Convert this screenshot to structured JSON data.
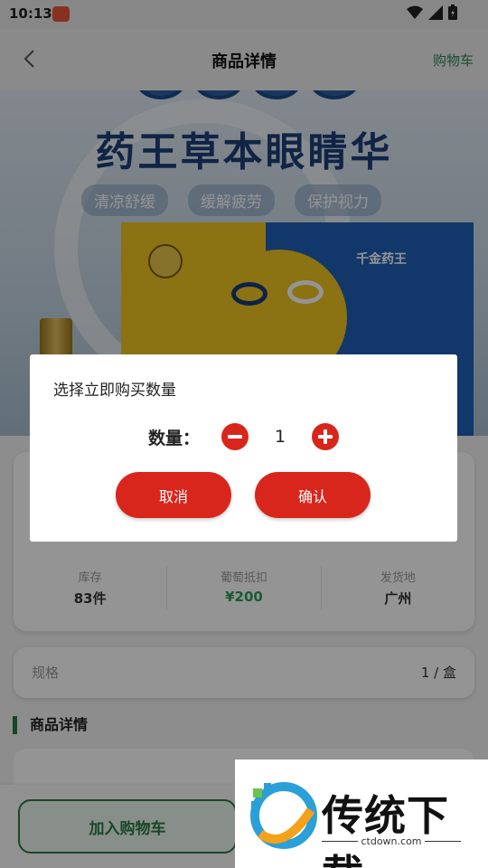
{
  "status_bar": {
    "time": "10:13"
  },
  "nav": {
    "title": "商品详情",
    "cart_link": "购物车"
  },
  "banner": {
    "headline": "药王草本眼睛华",
    "tags": [
      "清凉舒缓",
      "缓解疲劳",
      "保护视力"
    ],
    "box_brand": "千金药王"
  },
  "stats": [
    {
      "label": "库存",
      "value": "83件"
    },
    {
      "label": "葡萄抵扣",
      "value": "¥200"
    },
    {
      "label": "发货地",
      "value": "广州"
    }
  ],
  "spec": {
    "label": "规格",
    "value": "1 / 盒"
  },
  "section": {
    "title": "商品详情"
  },
  "bottom": {
    "add_to_cart": "加入购物车"
  },
  "dialog": {
    "title": "选择立即购买数量",
    "quantity_label": "数量：",
    "quantity": "1",
    "cancel": "取消",
    "confirm": "确认"
  },
  "watermark": {
    "brand": "传统下载",
    "domain": "ctdown.com"
  },
  "colors": {
    "accent_red": "#d9261c",
    "brand_green": "#2a7a45",
    "price_green": "#2a9d5a"
  }
}
